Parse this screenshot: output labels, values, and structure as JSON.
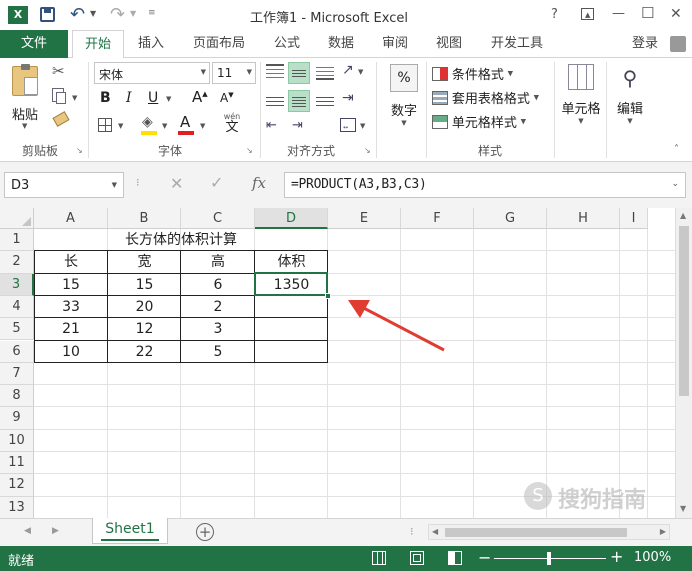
{
  "titlebar": {
    "title": "工作簿1 - Microsoft Excel",
    "help": "?",
    "minimize": "—",
    "maximize": "☐",
    "close": "✕"
  },
  "ribbon_tabs": {
    "file": "文件",
    "items": [
      "开始",
      "插入",
      "页面布局",
      "公式",
      "数据",
      "审阅",
      "视图",
      "开发工具"
    ],
    "login": "登录"
  },
  "ribbon": {
    "paste": "粘贴",
    "clipboard": "剪贴板",
    "font_name": "宋体",
    "font_size": "11",
    "font_group": "字体",
    "bold": "B",
    "italic": "I",
    "underline": "U",
    "grow": "A",
    "shrink": "A",
    "wen": "wén",
    "wen_char": "文",
    "align_group": "对齐方式",
    "number": "数字",
    "number_symbol": "%",
    "cond_format": "条件格式",
    "table_format": "套用表格格式",
    "cell_style": "单元格样式",
    "styles_group": "样式",
    "cells": "单元格",
    "editing": "编辑"
  },
  "formula_bar": {
    "name_box": "D3",
    "fx": "fx",
    "formula": "=PRODUCT(A3,B3,C3)"
  },
  "grid": {
    "columns": [
      "A",
      "B",
      "C",
      "D",
      "E",
      "F",
      "G",
      "H",
      "I"
    ],
    "rows": [
      "1",
      "2",
      "3",
      "4",
      "5",
      "6",
      "7",
      "8",
      "9",
      "10",
      "11",
      "12",
      "13"
    ],
    "title": "长方体的体积计算",
    "headers": [
      "长",
      "宽",
      "高",
      "体积"
    ],
    "data": [
      [
        "15",
        "15",
        "6",
        "1350"
      ],
      [
        "33",
        "20",
        "2",
        ""
      ],
      [
        "21",
        "12",
        "3",
        ""
      ],
      [
        "10",
        "22",
        "5",
        ""
      ]
    ]
  },
  "sheets": {
    "active": "Sheet1",
    "add": "+"
  },
  "status": {
    "ready": "就绪",
    "zoom": "100%",
    "minus": "−",
    "plus": "+"
  },
  "watermark": "搜狗指南",
  "colors": {
    "excel_green": "#217346",
    "arrow_red": "#e03c31",
    "font_red": "#e02020",
    "highlight_yellow": "#ffe000"
  }
}
